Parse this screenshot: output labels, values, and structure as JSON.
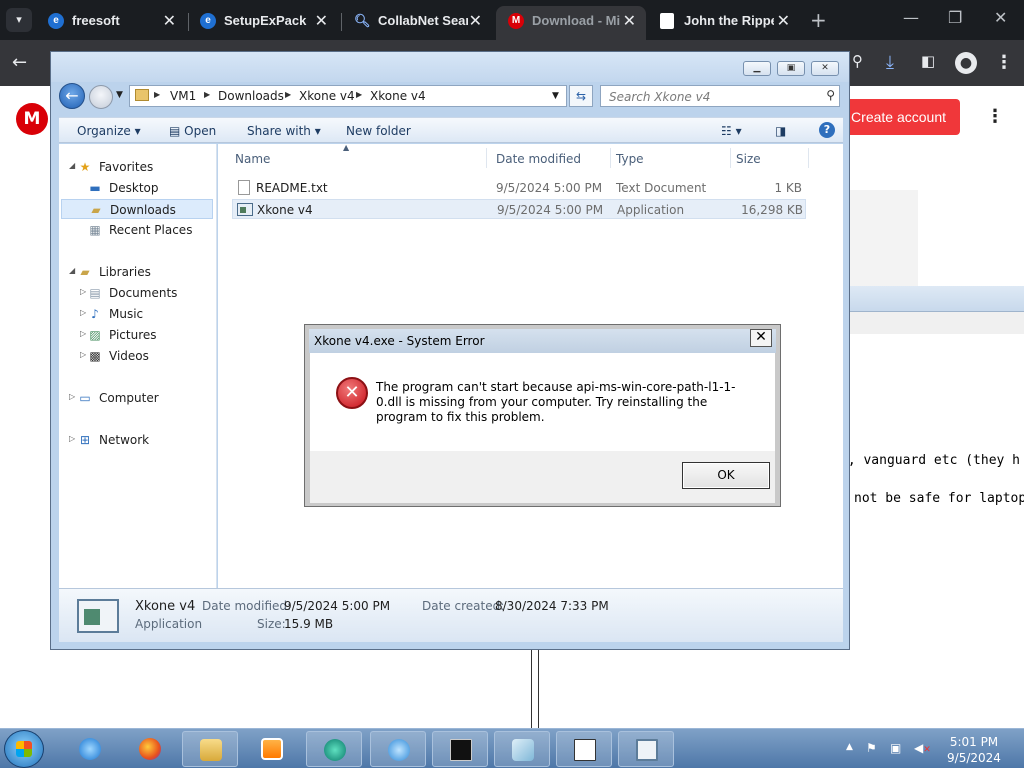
{
  "browser": {
    "tabs": [
      {
        "title": "freesoft",
        "icon": "edge-like-icon",
        "active": false
      },
      {
        "title": "SetupExPack",
        "icon": "edge-like-icon",
        "active": false
      },
      {
        "title": "CollabNet Sear",
        "icon": "search-icon",
        "active": false
      },
      {
        "title": "Download - Mi",
        "icon": "mega-icon",
        "active": true
      },
      {
        "title": "John the Rippe",
        "icon": "page-icon",
        "active": false
      }
    ],
    "new_tab": "+",
    "create_account": "Create account",
    "logo_letter": "M"
  },
  "background_page": {
    "text_line1": "t, vanguard etc (they h",
    "text_line2": "not be safe for laptop"
  },
  "explorer": {
    "breadcrumb": [
      "VM1",
      "Downloads",
      "Xkone v4",
      "Xkone v4"
    ],
    "search_placeholder": "Search Xkone v4",
    "commands": {
      "organize": "Organize",
      "open": "Open",
      "share_with": "Share with",
      "new_folder": "New folder"
    },
    "nav": {
      "favorites": "Favorites",
      "desktop": "Desktop",
      "downloads": "Downloads",
      "recent_places": "Recent Places",
      "libraries": "Libraries",
      "documents": "Documents",
      "music": "Music",
      "pictures": "Pictures",
      "videos": "Videos",
      "computer": "Computer",
      "network": "Network"
    },
    "columns": {
      "name": "Name",
      "date_modified": "Date modified",
      "type": "Type",
      "size": "Size"
    },
    "files": [
      {
        "name": "README.txt",
        "date": "9/5/2024 5:00 PM",
        "type": "Text Document",
        "size": "1 KB"
      },
      {
        "name": "Xkone v4",
        "date": "9/5/2024 5:00 PM",
        "type": "Application",
        "size": "16,298 KB"
      }
    ],
    "details": {
      "name": "Xkone v4",
      "kind": "Application",
      "date_modified_label": "Date modified:",
      "date_modified": "9/5/2024 5:00 PM",
      "size_label": "Size:",
      "size": "15.9 MB",
      "date_created_label": "Date created:",
      "date_created": "8/30/2024 7:33 PM"
    }
  },
  "dialog": {
    "title": "Xkone v4.exe - System Error",
    "message": "The program can't start because api-ms-win-core-path-l1-1-0.dll is missing from your computer. Try reinstalling the program to fix this problem.",
    "ok": "OK"
  },
  "taskbar": {
    "time": "5:01 PM",
    "date": "9/5/2024"
  }
}
